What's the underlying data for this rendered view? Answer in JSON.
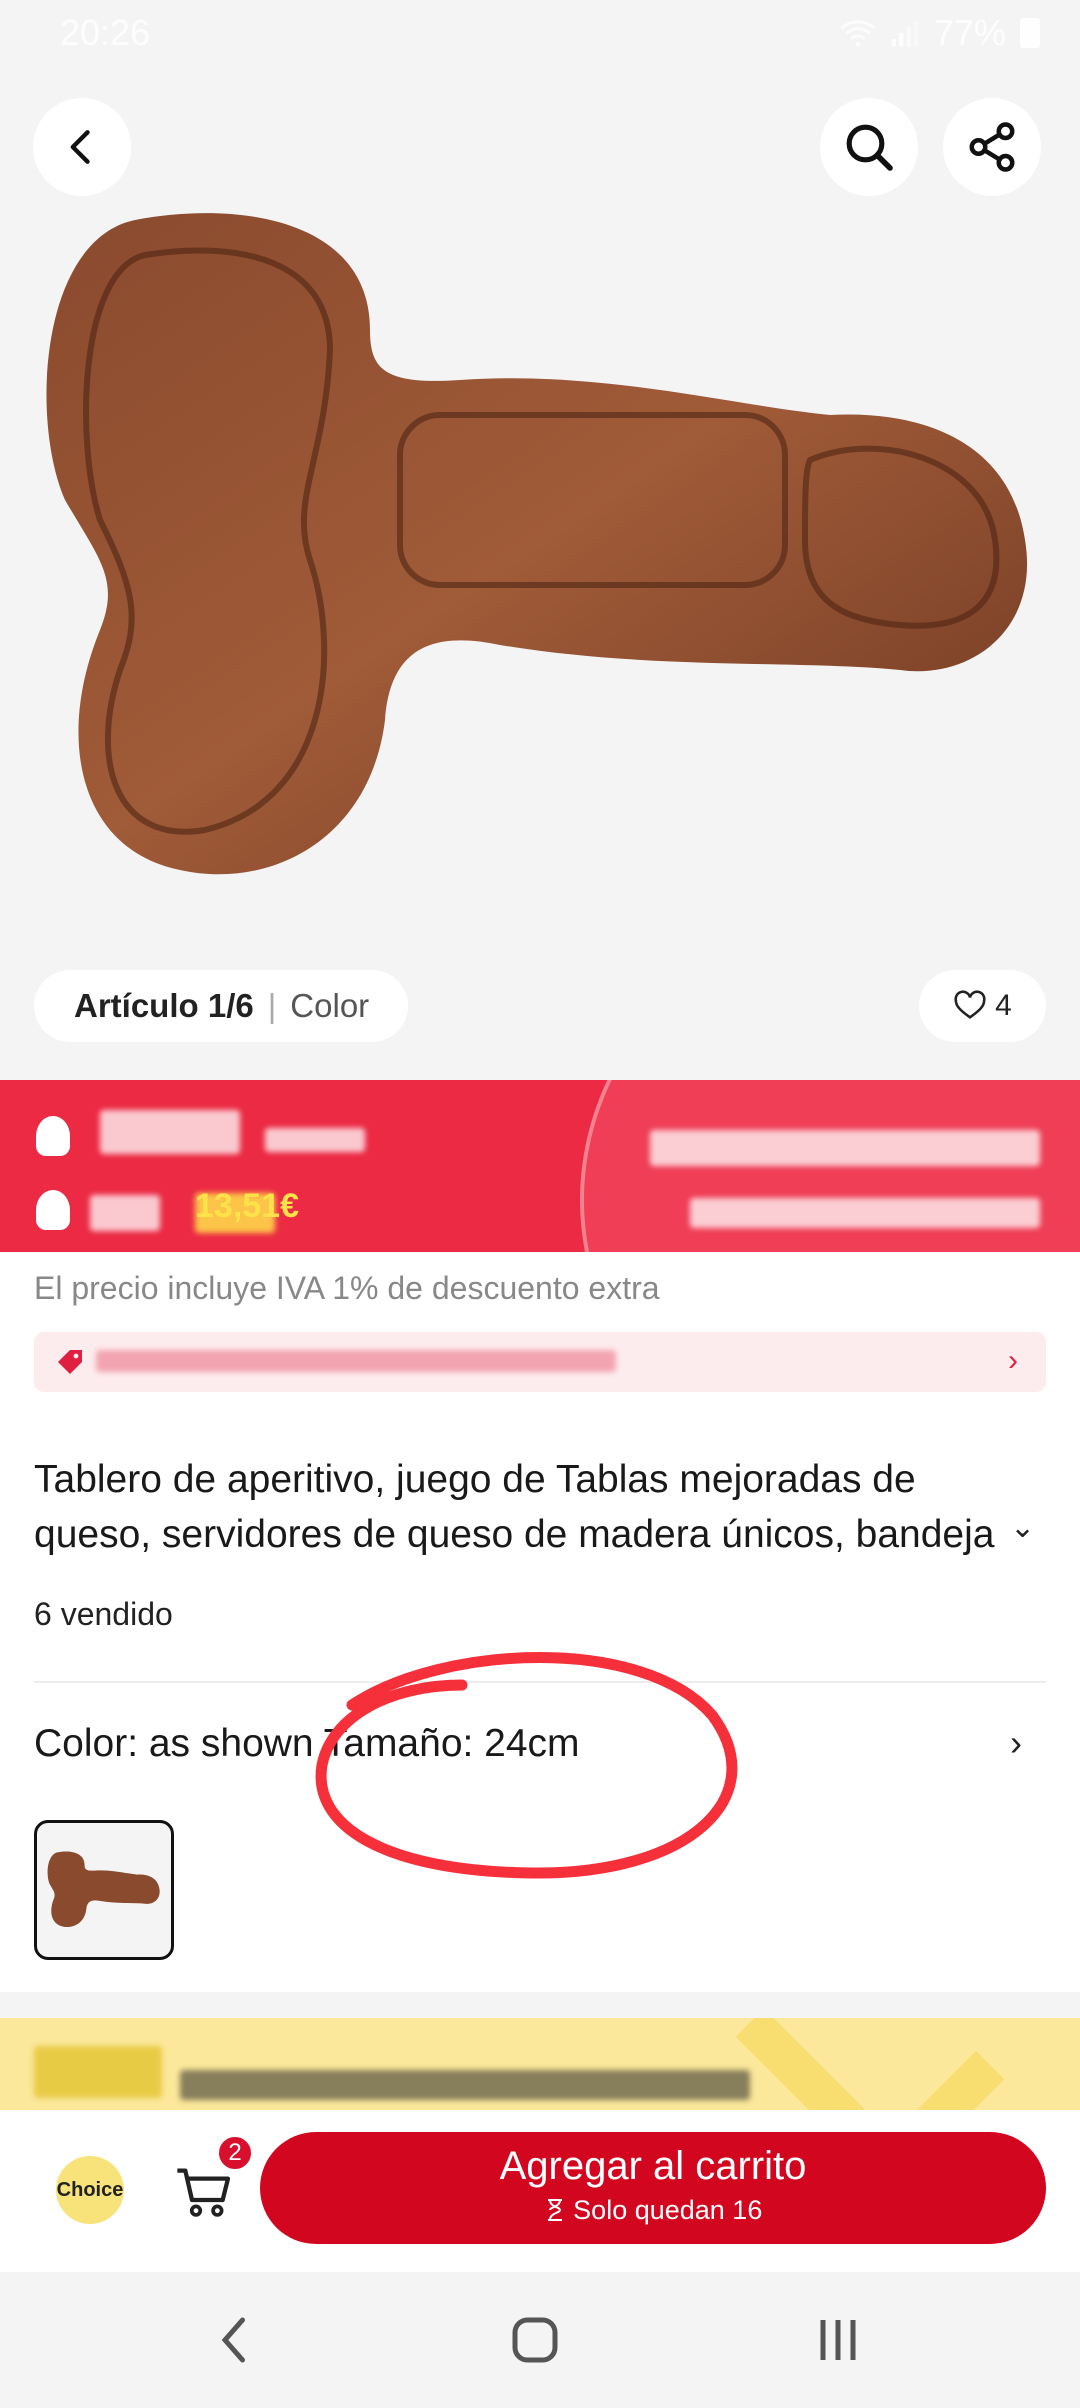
{
  "status_bar": {
    "time": "20:26",
    "battery": "77%"
  },
  "gallery": {
    "article_label": "Artículo 1/6",
    "separator": "|",
    "section_label": "Color",
    "favorites_count": "4"
  },
  "promo": {
    "price_text": "13,51€"
  },
  "product": {
    "vat_note": "El precio incluye IVA 1% de descuento extra",
    "title": "Tablero de aperitivo, juego de Tablas mejoradas de queso, servidores de queso de madera únicos, bandeja",
    "sold": "6 vendido",
    "variant": "Color: as shown Tamaño: 24cm"
  },
  "action_bar": {
    "choice_badge": "Choice",
    "cart_count": "2",
    "add_to_cart": "Agregar al carrito",
    "stock_note": "Solo quedan 16"
  },
  "colors": {
    "accent": "#d3061f",
    "promo_red": "#ec2a44",
    "annotation": "#f5303a"
  },
  "icons": [
    "back-icon",
    "search-icon",
    "share-icon",
    "heart-icon",
    "cart-icon",
    "hourglass-icon",
    "chevron-right-icon",
    "chevron-down-icon"
  ]
}
